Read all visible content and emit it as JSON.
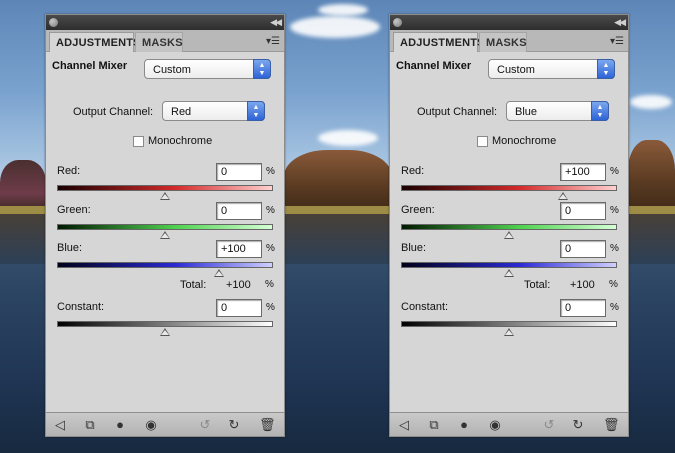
{
  "panels": [
    {
      "tabs": {
        "adjustments": "ADJUSTMENTS",
        "masks": "MASKS"
      },
      "preset_label": "Channel Mixer",
      "preset_value": "Custom",
      "output_label": "Output Channel:",
      "output_value": "Red",
      "monochrome_label": "Monochrome",
      "monochrome_checked": false,
      "sliders": {
        "red": {
          "label": "Red:",
          "value": "0",
          "numeric": 0
        },
        "green": {
          "label": "Green:",
          "value": "0",
          "numeric": 0
        },
        "blue": {
          "label": "Blue:",
          "value": "+100",
          "numeric": 100
        },
        "constant": {
          "label": "Constant:",
          "value": "0",
          "numeric": 0
        }
      },
      "pct": "%",
      "total_label": "Total:",
      "total_value": "+100",
      "total_pct": "%"
    },
    {
      "tabs": {
        "adjustments": "ADJUSTMENTS",
        "masks": "MASKS"
      },
      "preset_label": "Channel Mixer",
      "preset_value": "Custom",
      "output_label": "Output Channel:",
      "output_value": "Blue",
      "monochrome_label": "Monochrome",
      "monochrome_checked": false,
      "sliders": {
        "red": {
          "label": "Red:",
          "value": "+100",
          "numeric": 100
        },
        "green": {
          "label": "Green:",
          "value": "0",
          "numeric": 0
        },
        "blue": {
          "label": "Blue:",
          "value": "0",
          "numeric": 0
        },
        "constant": {
          "label": "Constant:",
          "value": "0",
          "numeric": 0
        }
      },
      "pct": "%",
      "total_label": "Total:",
      "total_value": "+100",
      "total_pct": "%"
    }
  ],
  "slider_range": [
    -200,
    200
  ],
  "colors": {
    "red_track": [
      "#1a0000",
      "#d42a2a",
      "#ffd0d0"
    ],
    "green_track": [
      "#001a00",
      "#4fd24f",
      "#d6ffd6"
    ],
    "blue_track": [
      "#00001a",
      "#2a2ad4",
      "#d0d0ff"
    ],
    "constant_track": [
      "#000000",
      "#888888",
      "#ffffff"
    ],
    "select_arrow": "#2e63d6"
  },
  "icons": [
    "back-arrow-icon",
    "expand-view-icon",
    "clip-layer-icon",
    "visibility-eye-icon",
    "previous-state-icon",
    "reset-icon",
    "trash-icon"
  ]
}
